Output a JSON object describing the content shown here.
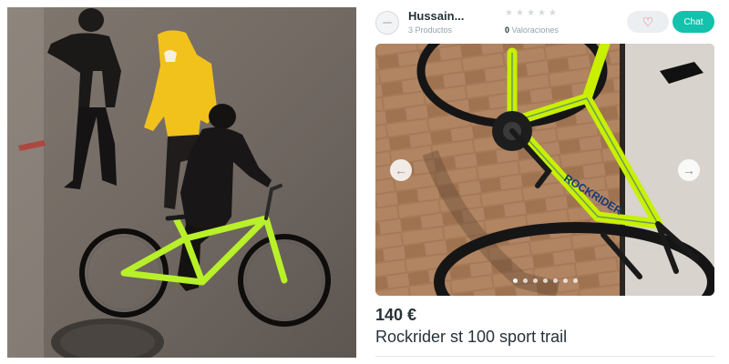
{
  "seller": {
    "name": "Hussain...",
    "products": "3 Productos",
    "ratings_count": "0",
    "ratings_label": " Valoraciones",
    "star_rating": 0
  },
  "actions": {
    "favorite_icon": "heart-icon",
    "chat_label": "Chat"
  },
  "gallery": {
    "image_count": 7,
    "active_index": 0,
    "bike_brand_text": "ROCKRIDER",
    "prev_icon": "arrow-left-icon",
    "next_icon": "arrow-right-icon"
  },
  "listing": {
    "price": "140 €",
    "title": "Rockrider st 100 sport trail"
  },
  "colors": {
    "accent": "#13c1ac",
    "heart": "#e0566a",
    "text": "#253238",
    "muted": "#90a4ae",
    "bike_frame": "#c8f000"
  }
}
